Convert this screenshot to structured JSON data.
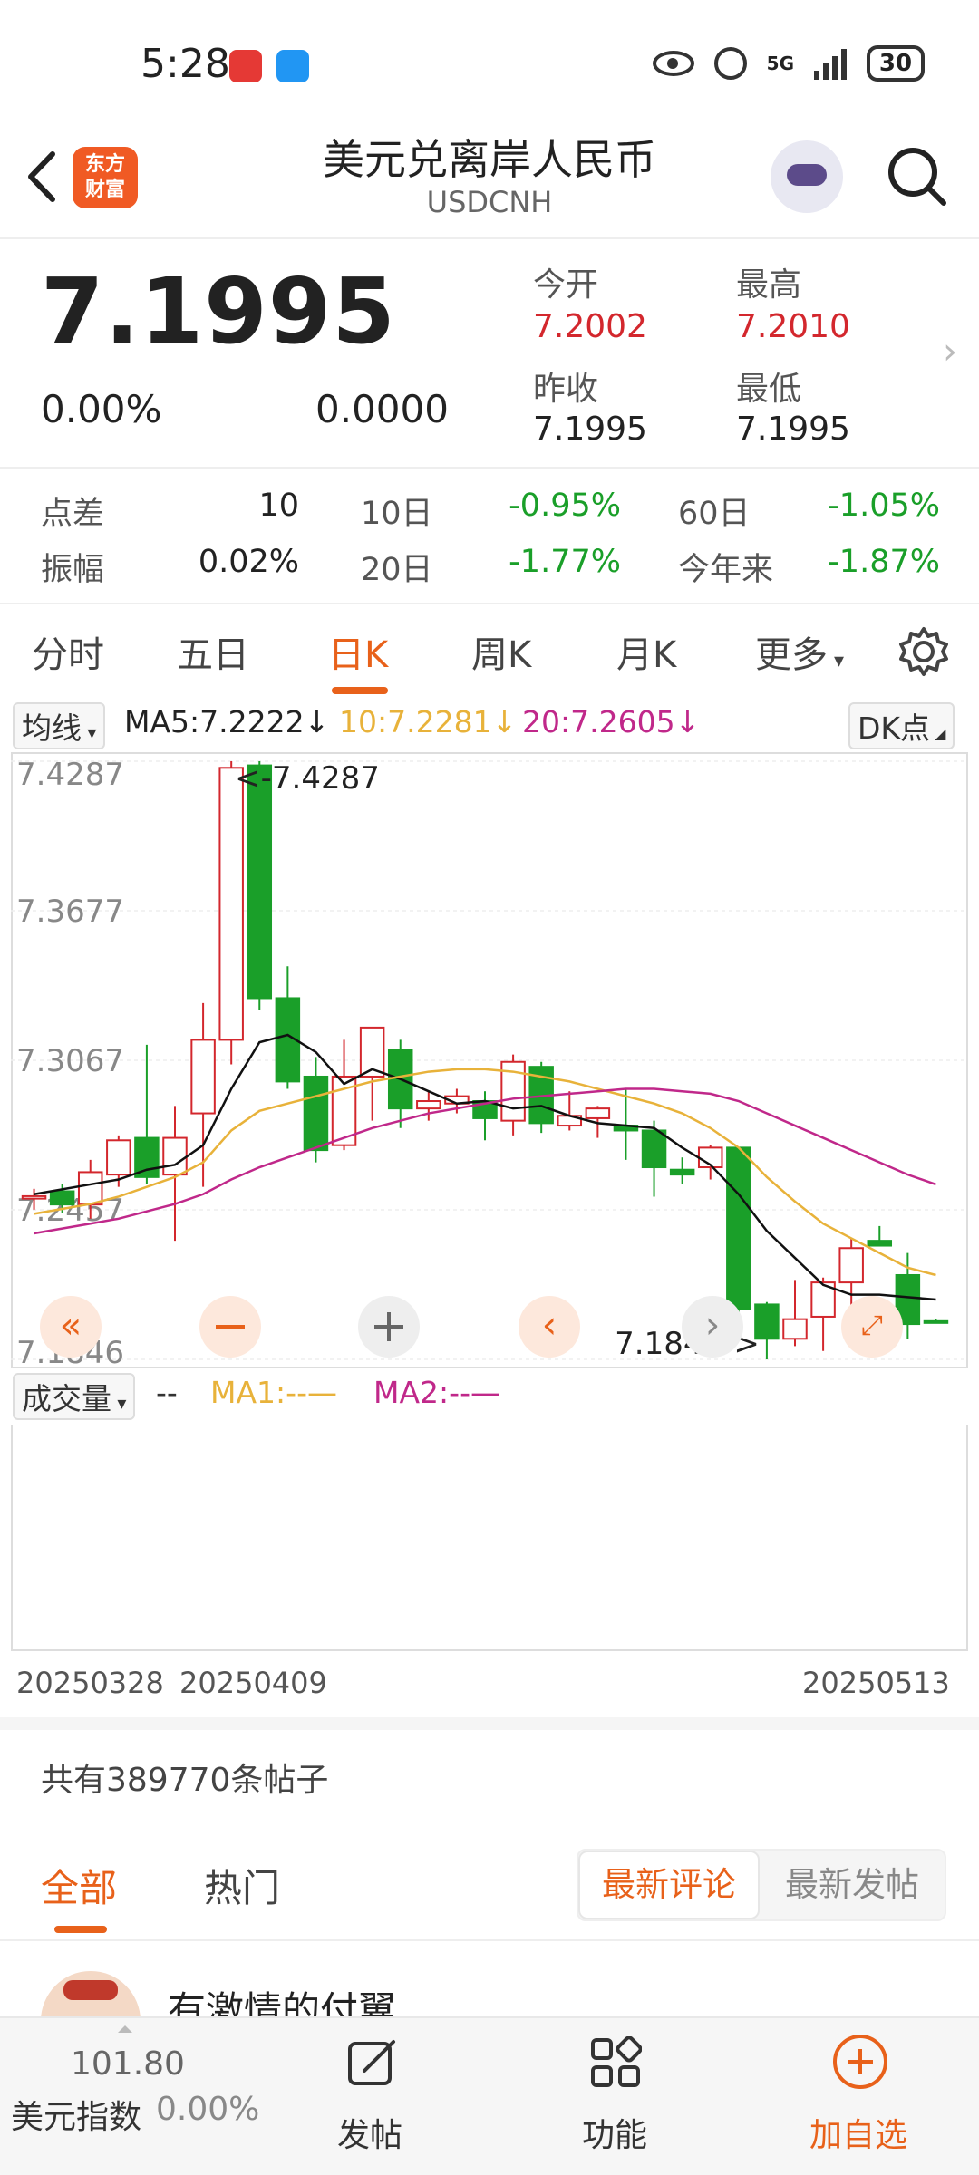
{
  "status": {
    "time": "5:28",
    "network": "5G",
    "battery": "30"
  },
  "header": {
    "title": "美元兑离岸人民币",
    "symbol": "USDCNH",
    "logo_line1": "东方",
    "logo_line2": "财富"
  },
  "quote": {
    "price": "7.1995",
    "change_pct": "0.00%",
    "change_val": "0.0000",
    "open_label": "今开",
    "open": "7.2002",
    "high_label": "最高",
    "high": "7.2010",
    "prev_close_label": "昨收",
    "prev_close": "7.1995",
    "low_label": "最低",
    "low": "7.1995"
  },
  "stats": {
    "spread_label": "点差",
    "spread": "10",
    "amplitude_label": "振幅",
    "amplitude": "0.02%",
    "d10_label": "10日",
    "d10": "-0.95%",
    "d20_label": "20日",
    "d20": "-1.77%",
    "d60_label": "60日",
    "d60": "-1.05%",
    "ytd_label": "今年来",
    "ytd": "-1.87%"
  },
  "tabs": [
    "分时",
    "五日",
    "日K",
    "周K",
    "月K",
    "更多"
  ],
  "ma": {
    "selector": "均线",
    "ma5": "MA5:7.2222",
    "ma10": "10:7.2281",
    "ma20": "20:7.2605",
    "dk": "DK点",
    "arrow": "↓"
  },
  "chart_data": {
    "type": "candlestick",
    "ylim": [
      7.1846,
      7.4287
    ],
    "y_ticks": [
      "7.4287",
      "7.3677",
      "7.3067",
      "7.2457",
      "7.1846"
    ],
    "max_label": "<-7.4287",
    "min_label": "7.1846->",
    "candles": [
      {
        "o": 7.2502,
        "h": 7.2542,
        "l": 7.2457,
        "c": 7.2512
      },
      {
        "o": 7.2532,
        "h": 7.2562,
        "l": 7.2442,
        "c": 7.2478
      },
      {
        "o": 7.2478,
        "h": 7.266,
        "l": 7.242,
        "c": 7.261
      },
      {
        "o": 7.26,
        "h": 7.276,
        "l": 7.255,
        "c": 7.274
      },
      {
        "o": 7.275,
        "h": 7.313,
        "l": 7.256,
        "c": 7.259
      },
      {
        "o": 7.26,
        "h": 7.288,
        "l": 7.233,
        "c": 7.275
      },
      {
        "o": 7.285,
        "h": 7.33,
        "l": 7.255,
        "c": 7.315
      },
      {
        "o": 7.315,
        "h": 7.4287,
        "l": 7.305,
        "c": 7.426
      },
      {
        "o": 7.427,
        "h": 7.4287,
        "l": 7.327,
        "c": 7.332
      },
      {
        "o": 7.332,
        "h": 7.345,
        "l": 7.295,
        "c": 7.298
      },
      {
        "o": 7.3,
        "h": 7.308,
        "l": 7.265,
        "c": 7.27
      },
      {
        "o": 7.272,
        "h": 7.315,
        "l": 7.27,
        "c": 7.3
      },
      {
        "o": 7.3,
        "h": 7.32,
        "l": 7.282,
        "c": 7.32
      },
      {
        "o": 7.311,
        "h": 7.315,
        "l": 7.279,
        "c": 7.287
      },
      {
        "o": 7.287,
        "h": 7.294,
        "l": 7.282,
        "c": 7.29
      },
      {
        "o": 7.289,
        "h": 7.295,
        "l": 7.285,
        "c": 7.292
      },
      {
        "o": 7.29,
        "h": 7.294,
        "l": 7.274,
        "c": 7.283
      },
      {
        "o": 7.282,
        "h": 7.309,
        "l": 7.276,
        "c": 7.306
      },
      {
        "o": 7.304,
        "h": 7.306,
        "l": 7.277,
        "c": 7.281
      },
      {
        "o": 7.28,
        "h": 7.294,
        "l": 7.278,
        "c": 7.284
      },
      {
        "o": 7.283,
        "h": 7.288,
        "l": 7.275,
        "c": 7.287
      },
      {
        "o": 7.28,
        "h": 7.295,
        "l": 7.266,
        "c": 7.278
      },
      {
        "o": 7.278,
        "h": 7.282,
        "l": 7.251,
        "c": 7.263
      },
      {
        "o": 7.262,
        "h": 7.267,
        "l": 7.256,
        "c": 7.26
      },
      {
        "o": 7.263,
        "h": 7.272,
        "l": 7.258,
        "c": 7.271
      },
      {
        "o": 7.271,
        "h": 7.271,
        "l": 7.202,
        "c": 7.205
      },
      {
        "o": 7.207,
        "h": 7.208,
        "l": 7.1846,
        "c": 7.193
      },
      {
        "o": 7.193,
        "h": 7.217,
        "l": 7.19,
        "c": 7.201
      },
      {
        "o": 7.202,
        "h": 7.218,
        "l": 7.188,
        "c": 7.216
      },
      {
        "o": 7.216,
        "h": 7.234,
        "l": 7.199,
        "c": 7.23
      },
      {
        "o": 7.233,
        "h": 7.239,
        "l": 7.231,
        "c": 7.231
      },
      {
        "o": 7.219,
        "h": 7.228,
        "l": 7.193,
        "c": 7.199
      },
      {
        "o": 7.2002,
        "h": 7.201,
        "l": 7.1995,
        "c": 7.1995
      }
    ],
    "ma5": [
      7.252,
      7.254,
      7.256,
      7.258,
      7.262,
      7.264,
      7.272,
      7.295,
      7.314,
      7.317,
      7.31,
      7.297,
      7.303,
      7.299,
      7.294,
      7.289,
      7.29,
      7.287,
      7.288,
      7.284,
      7.281,
      7.28,
      7.279,
      7.271,
      7.264,
      7.252,
      7.237,
      7.226,
      7.215,
      7.211,
      7.211,
      7.21,
      7.209
    ],
    "ma10": [
      7.244,
      7.246,
      7.248,
      7.251,
      7.255,
      7.259,
      7.265,
      7.278,
      7.286,
      7.289,
      7.292,
      7.295,
      7.298,
      7.3,
      7.302,
      7.303,
      7.303,
      7.302,
      7.3,
      7.298,
      7.295,
      7.292,
      7.289,
      7.285,
      7.279,
      7.271,
      7.259,
      7.249,
      7.24,
      7.234,
      7.228,
      7.222,
      7.219
    ],
    "ma20": [
      7.236,
      7.238,
      7.24,
      7.242,
      7.245,
      7.248,
      7.252,
      7.258,
      7.263,
      7.267,
      7.271,
      7.275,
      7.279,
      7.282,
      7.285,
      7.287,
      7.289,
      7.291,
      7.292,
      7.293,
      7.294,
      7.295,
      7.295,
      7.294,
      7.293,
      7.29,
      7.285,
      7.28,
      7.275,
      7.27,
      7.265,
      7.26,
      7.256
    ]
  },
  "volume": {
    "selector": "成交量",
    "dashes": "--",
    "ma1": "MA1:--",
    "ma2": "MA2:--"
  },
  "dates": {
    "start": "20250328",
    "mid": "20250409",
    "end": "20250513"
  },
  "posts": {
    "count_text": "共有389770条帖子",
    "tab_all": "全部",
    "tab_hot": "热门",
    "sort_latest_comment": "最新评论",
    "sort_latest_post": "最新发帖",
    "first_user": "有激情的付翼"
  },
  "bottom": {
    "index_value": "101.80",
    "index_name": "美元指数",
    "index_change": "0.00%",
    "post": "发帖",
    "function": "功能",
    "add": "加自选"
  },
  "colors": {
    "up": "#d3272d",
    "down": "#1a9f29",
    "accent": "#e8611a",
    "ma5": "#111111",
    "ma10": "#e8b23a",
    "ma20": "#c0288a"
  }
}
